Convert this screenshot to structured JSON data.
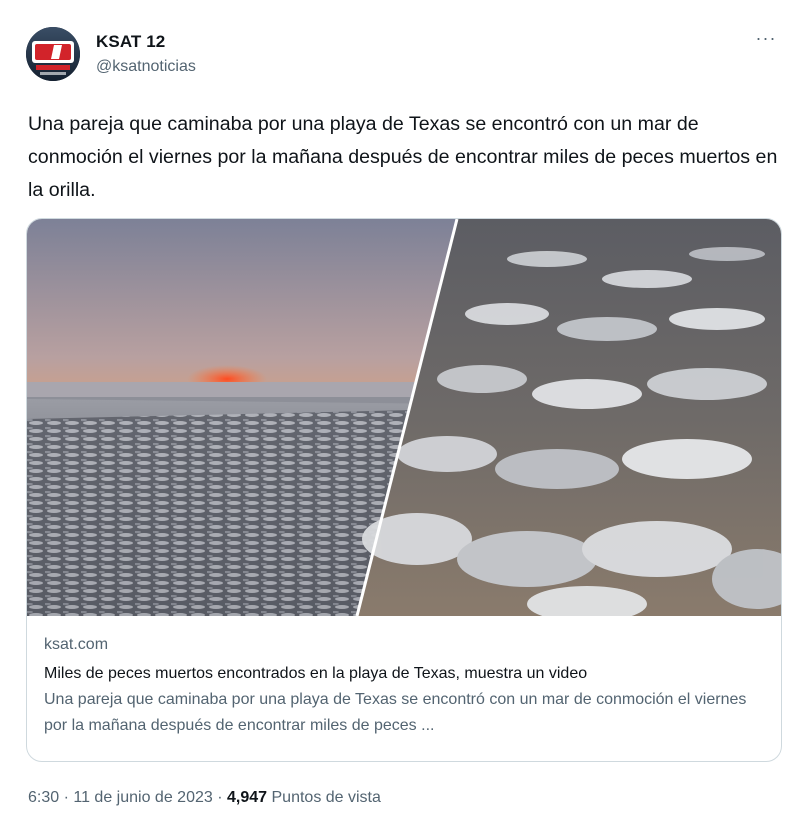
{
  "author": {
    "name": "KSAT 12",
    "handle": "@ksatnoticias",
    "avatar_logo": "KSAT 12"
  },
  "menu": {
    "more_icon": "more-horizontal-icon",
    "more_glyph": "···"
  },
  "tweet": {
    "text": "Una pareja que caminaba por una playa de Texas se encontró con un mar de conmoción el viernes por la mañana después de encontrar miles de peces muertos en la orilla."
  },
  "card": {
    "domain": "ksat.com",
    "title": "Miles de peces muertos encontrados en la playa de Texas, muestra un video",
    "description": "Una pareja que caminaba por una playa de Texas se encontró con un mar de conmoción el viernes por la mañana después de encontrar miles de peces ..."
  },
  "footer": {
    "time": "6:30",
    "separator": "·",
    "date": "11 de junio de 2023",
    "views_count": "4,947",
    "views_label": "Puntos de vista"
  },
  "colors": {
    "text_primary": "#0f1419",
    "text_secondary": "#536471",
    "border": "#cfd9de",
    "sunset_orange": "#f07a3c",
    "sky_gray": "#8a8ea0"
  }
}
